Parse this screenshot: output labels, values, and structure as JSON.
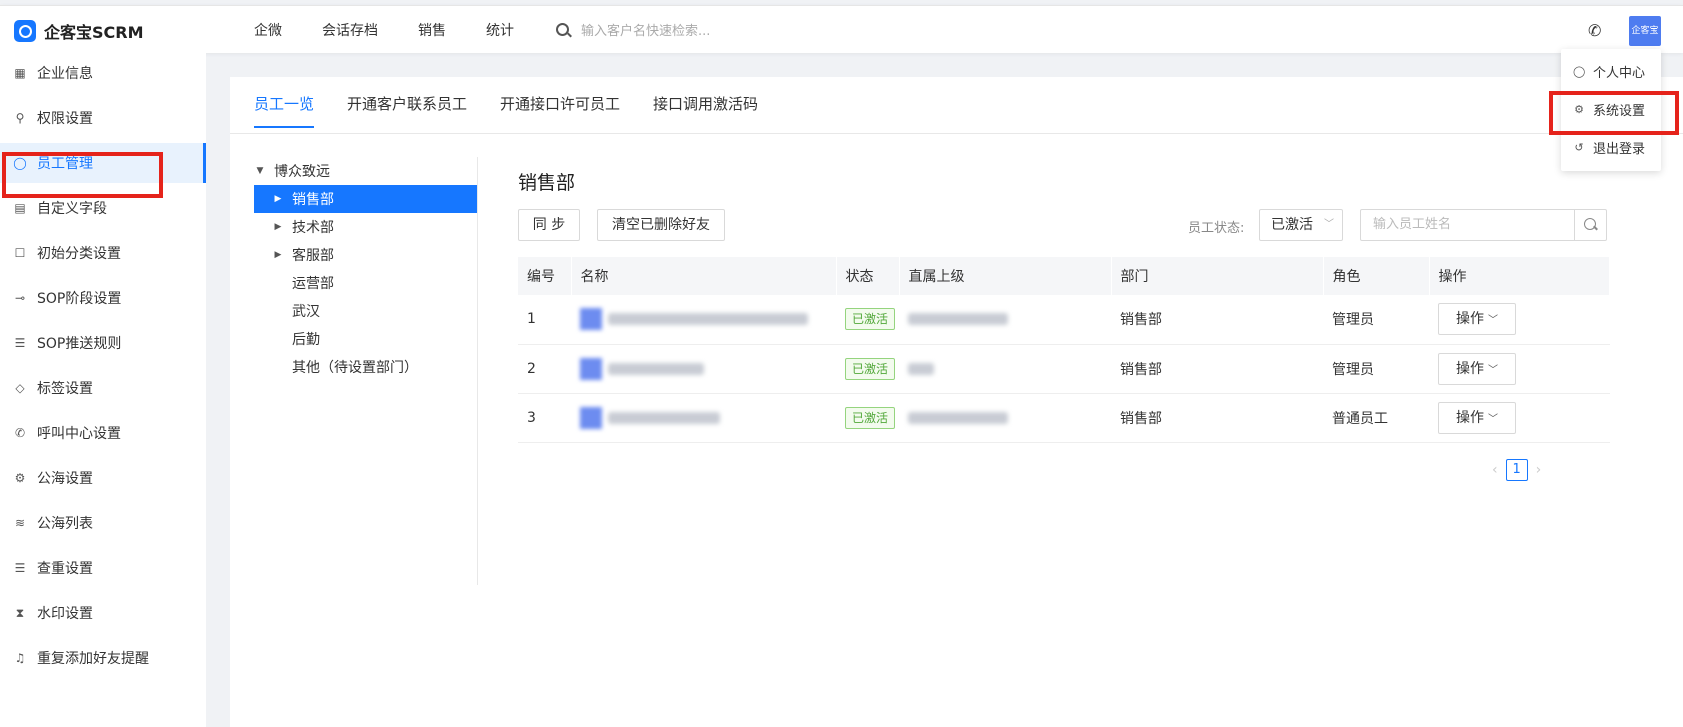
{
  "app": {
    "name": "企客宝SCRM"
  },
  "topnav": [
    "企微",
    "会话存档",
    "销售",
    "统计"
  ],
  "search": {
    "placeholder": "输入客户名快速检索..."
  },
  "user": {
    "avatar_text": "企客宝"
  },
  "user_menu": [
    {
      "label": "个人中心",
      "icon": "user-icon"
    },
    {
      "label": "系统设置",
      "icon": "gear-icon"
    },
    {
      "label": "退出登录",
      "icon": "logout-icon"
    }
  ],
  "sidebar": [
    {
      "label": "企业信息",
      "icon": "calendar-icon"
    },
    {
      "label": "权限设置",
      "icon": "key-icon"
    },
    {
      "label": "员工管理",
      "icon": "user-icon",
      "active": true
    },
    {
      "label": "自定义字段",
      "icon": "form-icon"
    },
    {
      "label": "初始分类设置",
      "icon": "square-icon"
    },
    {
      "label": "SOP阶段设置",
      "icon": "stage-icon"
    },
    {
      "label": "SOP推送规则",
      "icon": "list-icon"
    },
    {
      "label": "标签设置",
      "icon": "tag-icon"
    },
    {
      "label": "呼叫中心设置",
      "icon": "phone-icon"
    },
    {
      "label": "公海设置",
      "icon": "gear-icon"
    },
    {
      "label": "公海列表",
      "icon": "lines-icon"
    },
    {
      "label": "查重设置",
      "icon": "list-icon"
    },
    {
      "label": "水印设置",
      "icon": "hourglass-icon"
    },
    {
      "label": "重复添加好友提醒",
      "icon": "bell-icon"
    }
  ],
  "tabs": [
    "员工一览",
    "开通客户联系员工",
    "开通接口许可员工",
    "接口调用激活码"
  ],
  "tree": {
    "root": "博众致远",
    "children": [
      {
        "label": "销售部",
        "expandable": true,
        "selected": true
      },
      {
        "label": "技术部",
        "expandable": true
      },
      {
        "label": "客服部",
        "expandable": true
      },
      {
        "label": "运营部",
        "expandable": false
      },
      {
        "label": "武汉",
        "expandable": false
      },
      {
        "label": "后勤",
        "expandable": false
      },
      {
        "label": "其他（待设置部门）",
        "expandable": false
      }
    ]
  },
  "dept_title": "销售部",
  "buttons": {
    "sync": "同 步",
    "clear_deleted": "清空已删除好友"
  },
  "filter": {
    "label": "员工状态:",
    "value": "已激活",
    "search_placeholder": "输入员工姓名"
  },
  "table": {
    "columns": [
      "编号",
      "名称",
      "状态",
      "直属上级",
      "部门",
      "角色",
      "操作"
    ],
    "rows": [
      {
        "id": "1",
        "status": "已激活",
        "dept": "销售部",
        "role": "管理员",
        "action": "操作"
      },
      {
        "id": "2",
        "status": "已激活",
        "dept": "销售部",
        "role": "管理员",
        "action": "操作"
      },
      {
        "id": "3",
        "status": "已激活",
        "dept": "销售部",
        "role": "普通员工",
        "action": "操作"
      }
    ]
  },
  "pagination": {
    "current": "1"
  }
}
